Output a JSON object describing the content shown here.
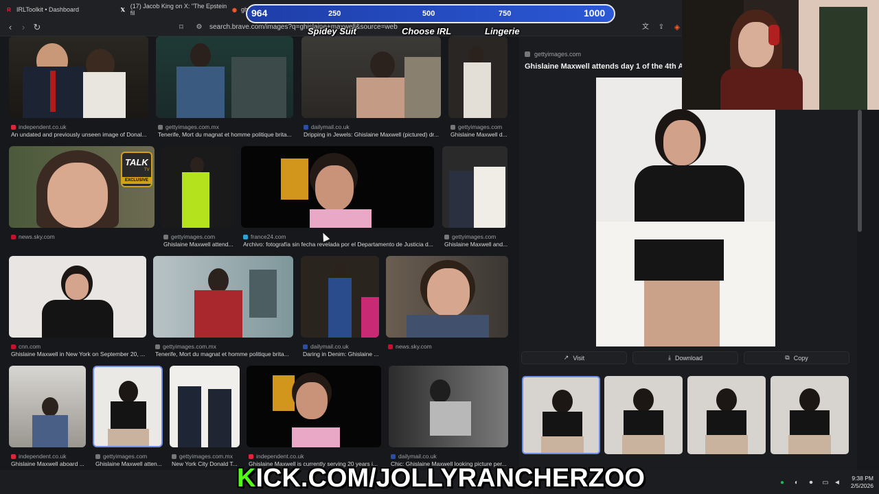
{
  "tabs": [
    {
      "label": "IRLToolkit • Dashboard",
      "icon": "irltoolkit-icon"
    },
    {
      "label": "(17) Jacob King on X: \"The Epstein fil",
      "icon": "x-logo-icon"
    },
    {
      "label": "gh",
      "icon": "brave-icon"
    }
  ],
  "address_bar": {
    "url": "search.brave.com/images?q=ghislaine+maxwell&source=web"
  },
  "results": [
    {
      "source": "independent.co.uk",
      "caption": "An undated and previously unseen image of Donal..."
    },
    {
      "source": "gettyimages.com.mx",
      "caption": "Tenerife, Mort du magnat et homme politique brita..."
    },
    {
      "source": "dailymail.co.uk",
      "caption": "Dripping in Jewels: Ghislaine Maxwell (pictured) dr..."
    },
    {
      "source": "gettyimages.com",
      "caption": "Ghislaine Maxwell d..."
    },
    {
      "source": "news.sky.com",
      "caption": ""
    },
    {
      "source": "gettyimages.com",
      "caption": "Ghislaine Maxwell attend..."
    },
    {
      "source": "france24.com",
      "caption": "Archivo: fotografía sin fecha revelada por el Departamento de Justicia d..."
    },
    {
      "source": "gettyimages.com",
      "caption": "Ghislaine Maxwell and..."
    },
    {
      "source": "cnn.com",
      "caption": "Ghislaine Maxwell in New York on September 20, ..."
    },
    {
      "source": "gettyimages.com.mx",
      "caption": "Tenerife, Mort du magnat et homme politique brita..."
    },
    {
      "source": "dailymail.co.uk",
      "caption": "Daring in Denim: Ghislaine ..."
    },
    {
      "source": "news.sky.com",
      "caption": ""
    },
    {
      "source": "independent.co.uk",
      "caption": "Ghislaine Maxwell aboard ..."
    },
    {
      "source": "gettyimages.com",
      "caption": "Ghislaine Maxwell atten..."
    },
    {
      "source": "gettyimages.com.mx",
      "caption": "New York City Donald T..."
    },
    {
      "source": "independent.co.uk",
      "caption": "Ghislaine Maxwell is currently serving 20 years i..."
    },
    {
      "source": "dailymail.co.uk",
      "caption": "Chic: Ghislaine Maxwell looking picture per..."
    }
  ],
  "badge": {
    "talk": "TALK",
    "tv": "TV",
    "exclusive": "EXCLUSIVE"
  },
  "detail": {
    "source": "gettyimages.com",
    "title": "Ghislaine Maxwell attends day 1 of the 4th Ar",
    "visit": "Visit",
    "download": "Download",
    "copy": "Copy"
  },
  "overlay": {
    "goal_values": [
      "964",
      "250",
      "500",
      "750",
      "1000"
    ],
    "goal_labels": [
      "Spidey Suit",
      "Choose IRL",
      "Lingerie"
    ],
    "kick_first": "K",
    "kick_rest": "ICK.COM/JOLLYRANCHERZOO"
  },
  "taskbar": {
    "time": "9:38 PM",
    "date": "2/5/2026"
  }
}
